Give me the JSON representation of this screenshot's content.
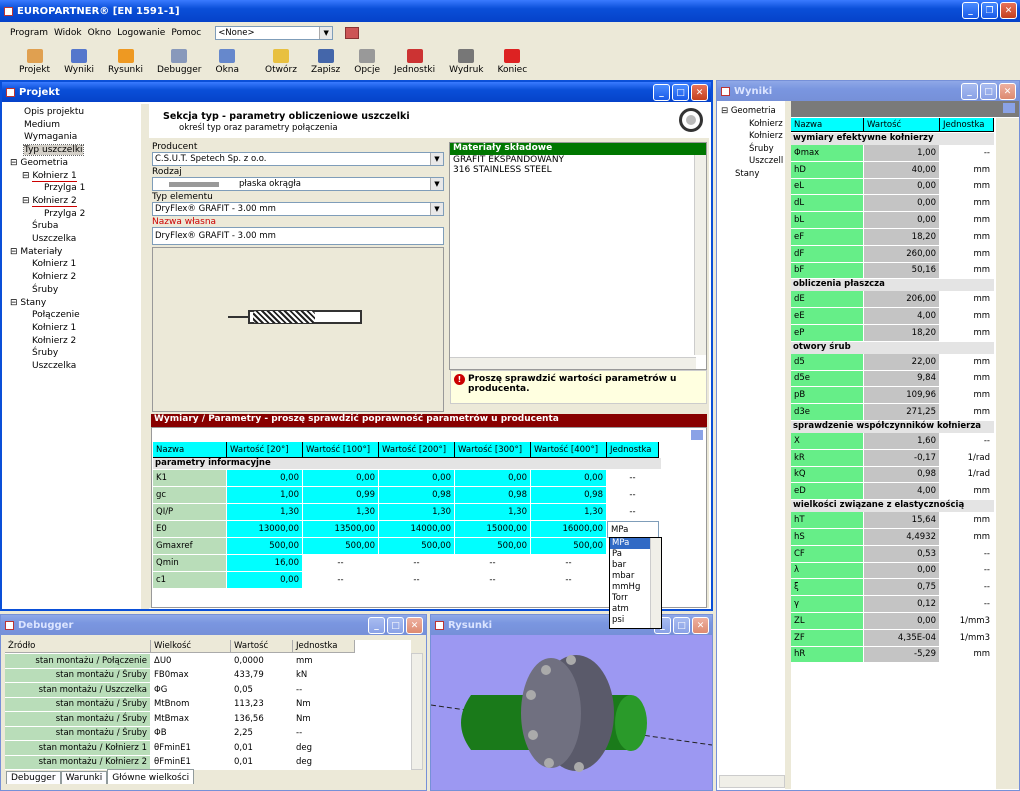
{
  "app": {
    "title": "EUROPARTNER® [EN 1591-1]"
  },
  "menu": [
    "Program",
    "Widok",
    "Okno",
    "Logowanie",
    "Pomoc"
  ],
  "combo_none": "<None>",
  "toolbar": [
    "Projekt",
    "Wyniki",
    "Rysunki",
    "Debugger",
    "Okna",
    "Otwórz",
    "Zapisz",
    "Opcje",
    "Jednostki",
    "Wydruk",
    "Koniec"
  ],
  "projekt": {
    "title": "Projekt",
    "tree": [
      "Opis projektu",
      "Medium",
      "Wymagania",
      "Typ uszczelki",
      "Geometria",
      "Kołnierz 1",
      "Przylga 1",
      "Kołnierz 2",
      "Przylga 2",
      "Śruba",
      "Uszczelka",
      "Materiały",
      "Kołnierz 1",
      "Kołnierz 2",
      "Śruby",
      "Stany",
      "Połączenie",
      "Kołnierz 1",
      "Kołnierz 2",
      "Śruby",
      "Uszczelka"
    ],
    "section_title": "Sekcja typ - parametry obliczeniowe uszczelki",
    "section_sub": "określ typ oraz parametry połączenia",
    "producent_label": "Producent",
    "producent": "C.S.U.T. Spetech Sp. z o.o.",
    "rodzaj_label": "Rodzaj",
    "rodzaj": "płaska okrągła",
    "typ_label": "Typ elementu",
    "typ": "DryFlex® GRAFIT - 3.00 mm",
    "nazwa_label": "Nazwa własna",
    "nazwa": "DryFlex® GRAFIT - 3.00 mm",
    "materialy_title": "Materiały składowe",
    "materialy": [
      "GRAFIT EKSPANDOWANY",
      "316 STAINLESS STEEL"
    ],
    "warning": "Proszę sprawdzić wartości parametrów u producenta.",
    "wymiary_title": "Wymiary / Parametry - proszę sprawdzić poprawność parametrów u producenta",
    "grid_headers": [
      "Nazwa",
      "Wartość [20°]",
      "Wartość [100°]",
      "Wartość [200°]",
      "Wartość [300°]",
      "Wartość [400°]",
      "Jednostka"
    ],
    "grid_section": "parametry informacyjne",
    "grid_rows": [
      [
        "K1",
        "0,00",
        "0,00",
        "0,00",
        "0,00",
        "0,00",
        "--"
      ],
      [
        "gc",
        "1,00",
        "0,99",
        "0,98",
        "0,98",
        "0,98",
        "--"
      ],
      [
        "QI/P",
        "1,30",
        "1,30",
        "1,30",
        "1,30",
        "1,30",
        "--"
      ],
      [
        "E0",
        "13000,00",
        "13500,00",
        "14000,00",
        "15000,00",
        "16000,00",
        "MPa"
      ],
      [
        "Gmaxref",
        "500,00",
        "500,00",
        "500,00",
        "500,00",
        "500,00",
        ""
      ],
      [
        "Qmin",
        "16,00",
        "--",
        "--",
        "--",
        "--",
        ""
      ],
      [
        "c1",
        "0,00",
        "--",
        "--",
        "--",
        "--",
        ""
      ]
    ],
    "unit_options": [
      "MPa",
      "Pa",
      "bar",
      "mbar",
      "mmHg",
      "Torr",
      "atm",
      "psi"
    ]
  },
  "wyniki": {
    "title": "Wyniki",
    "tree": [
      "Geometria",
      "Kołnierz",
      "Kołnierz",
      "Śruby",
      "Uszczell",
      "Stany"
    ],
    "headers": [
      "Nazwa",
      "Wartość",
      "Jednostka"
    ],
    "rows": [
      {
        "s": "wymiary efektywne kołnierzy"
      },
      [
        "Φmax",
        "1,00",
        "--"
      ],
      [
        "hD",
        "40,00",
        "mm"
      ],
      [
        "eL",
        "0,00",
        "mm"
      ],
      [
        "dL",
        "0,00",
        "mm"
      ],
      [
        "bL",
        "0,00",
        "mm"
      ],
      [
        "eF",
        "18,20",
        "mm"
      ],
      [
        "dF",
        "260,00",
        "mm"
      ],
      [
        "bF",
        "50,16",
        "mm"
      ],
      {
        "s": "obliczenia płaszcza"
      },
      [
        "dE",
        "206,00",
        "mm"
      ],
      [
        "eE",
        "4,00",
        "mm"
      ],
      [
        "eP",
        "18,20",
        "mm"
      ],
      {
        "s": "otwory śrub"
      },
      [
        "d5",
        "22,00",
        "mm"
      ],
      [
        "d5e",
        "9,84",
        "mm"
      ],
      [
        "pB",
        "109,96",
        "mm"
      ],
      [
        "d3e",
        "271,25",
        "mm"
      ],
      {
        "s": "sprawdzenie współczynników kołnierza"
      },
      [
        "X",
        "1,60",
        "--"
      ],
      [
        "kR",
        "-0,17",
        "1/rad"
      ],
      [
        "kQ",
        "0,98",
        "1/rad"
      ],
      [
        "eD",
        "4,00",
        "mm"
      ],
      {
        "s": "wielkości związane z elastycznością"
      },
      [
        "hT",
        "15,64",
        "mm"
      ],
      [
        "hS",
        "4,4932",
        "mm"
      ],
      [
        "CF",
        "0,53",
        "--"
      ],
      [
        "λ",
        "0,00",
        "--"
      ],
      [
        "ξ",
        "0,75",
        "--"
      ],
      [
        "γ",
        "0,12",
        "--"
      ],
      [
        "ZL",
        "0,00",
        "1/mm3"
      ],
      [
        "ZF",
        "4,35E-04",
        "1/mm3"
      ],
      [
        "hR",
        "-5,29",
        "mm"
      ]
    ]
  },
  "debugger": {
    "title": "Debugger",
    "headers": [
      "Źródło",
      "Wielkość",
      "Wartość",
      "Jednostka"
    ],
    "rows": [
      [
        "stan montażu / Połączenie",
        "ΔU0",
        "0,0000",
        "mm"
      ],
      [
        "stan montażu / Śruby",
        "FB0max",
        "433,79",
        "kN"
      ],
      [
        "stan montażu / Uszczelka",
        "ΦG",
        "0,05",
        "--"
      ],
      [
        "stan montażu / Śruby",
        "MtBnom",
        "113,23",
        "Nm"
      ],
      [
        "stan montażu / Śruby",
        "MtBmax",
        "136,56",
        "Nm"
      ],
      [
        "stan montażu / Śruby",
        "ΦB",
        "2,25",
        "--"
      ],
      [
        "stan montażu / Kołnierz 1",
        "θFminE1",
        "0,01",
        "deg"
      ],
      [
        "stan montażu / Kołnierz 2",
        "θFminE1",
        "0,01",
        "deg"
      ]
    ],
    "tabs": [
      "Debugger",
      "Warunki",
      "Główne wielkości"
    ]
  },
  "rysunki": {
    "title": "Rysunki"
  }
}
